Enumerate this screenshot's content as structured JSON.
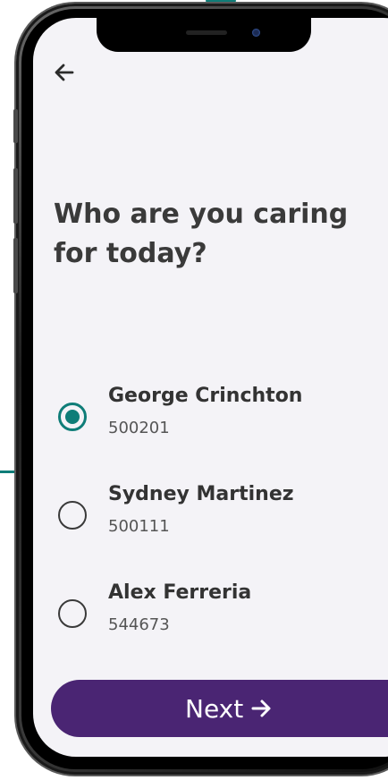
{
  "colors": {
    "teal": "#0f7d78",
    "purple": "#4a2573",
    "screen_bg": "#f4f3f7",
    "text_dark": "#3a3a3a"
  },
  "nav": {
    "back_icon": "arrow-left-icon"
  },
  "question": {
    "title": "Who are you caring\nfor today?"
  },
  "options": [
    {
      "name": "George Crinchton",
      "id": "500201",
      "selected": true
    },
    {
      "name": "Sydney Martinez",
      "id": "500111",
      "selected": false
    },
    {
      "name": "Alex Ferreria",
      "id": "544673",
      "selected": false
    }
  ],
  "actions": {
    "next_label": "Next",
    "next_icon": "arrow-right-icon"
  }
}
